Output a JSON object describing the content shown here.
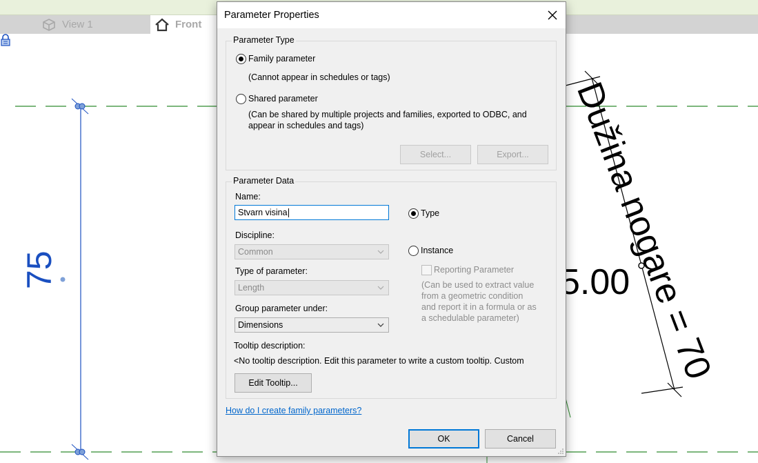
{
  "tabs": [
    {
      "label": "View 1",
      "icon": "cube-icon"
    },
    {
      "label": "Front",
      "icon": "house-icon"
    }
  ],
  "canvas": {
    "dimension_left": "75",
    "dimension_label": "Dužina nogare = 70",
    "dimension_value": "5.00"
  },
  "dialog": {
    "title": "Parameter Properties",
    "parameter_type": {
      "group_label": "Parameter Type",
      "family_label": "Family parameter",
      "family_desc": "(Cannot appear in schedules or tags)",
      "shared_label": "Shared parameter",
      "shared_desc_1": "(Can be shared by multiple projects and families, exported to ODBC, and",
      "shared_desc_2": "appear in schedules and tags)",
      "select_btn": "Select...",
      "export_btn": "Export...",
      "selected": "family"
    },
    "parameter_data": {
      "group_label": "Parameter Data",
      "name_label": "Name:",
      "name_value": "Stvarn visina",
      "discipline_label": "Discipline:",
      "discipline_value": "Common",
      "type_label": "Type of parameter:",
      "type_value": "Length",
      "group_under_label": "Group parameter under:",
      "group_under_value": "Dimensions",
      "type_radio": "Type",
      "instance_radio": "Instance",
      "selected": "type",
      "reporting_label": "Reporting Parameter",
      "reporting_desc_1": "(Can be used to extract value",
      "reporting_desc_2": "from a geometric condition",
      "reporting_desc_3": "and report it in a formula or as",
      "reporting_desc_4": "a schedulable parameter)",
      "tooltip_label": "Tooltip description:",
      "tooltip_text": "<No tooltip description. Edit this parameter to write a custom tooltip. Custom",
      "edit_tooltip_btn": "Edit Tooltip..."
    },
    "help_link": "How do I create family parameters?",
    "ok_btn": "OK",
    "cancel_btn": "Cancel"
  },
  "colors": {
    "accent": "#0078d7",
    "dimension_blue": "#1a4fc0",
    "ref_plane_green": "#2e8b2e"
  }
}
